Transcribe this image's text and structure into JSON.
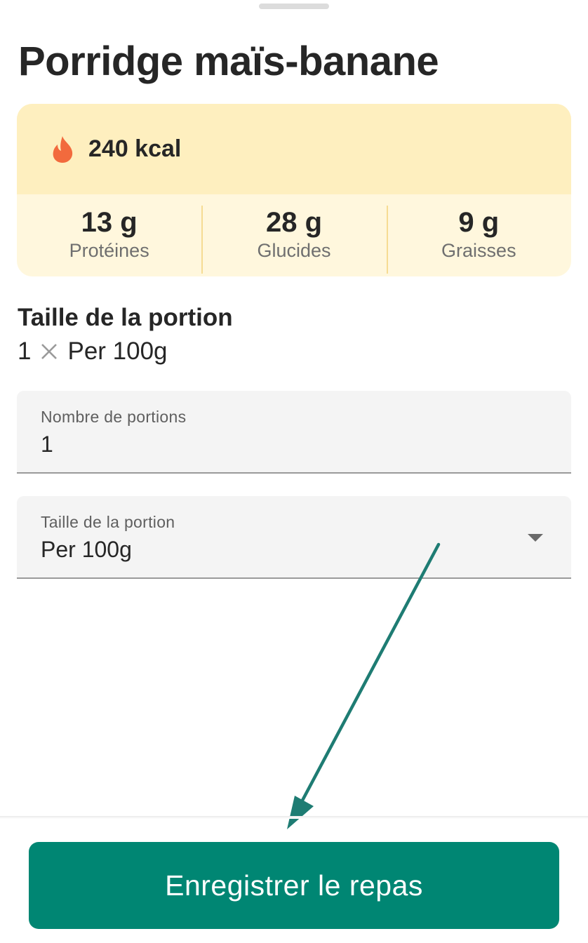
{
  "meal": {
    "title": "Porridge maïs-banane"
  },
  "nutrition": {
    "calories": "240 kcal",
    "calories_icon": "flame-icon",
    "macros": [
      {
        "value": "13 g",
        "label": "Protéines"
      },
      {
        "value": "28 g",
        "label": "Glucides"
      },
      {
        "value": "9 g",
        "label": "Graisses"
      }
    ]
  },
  "portion": {
    "heading": "Taille de la portion",
    "quantity": "1",
    "unit": "Per 100g"
  },
  "form": {
    "servings_label": "Nombre de portions",
    "servings_value": "1",
    "size_label": "Taille de la portion",
    "size_value": "Per 100g"
  },
  "actions": {
    "save_label": "Enregistrer le repas"
  },
  "colors": {
    "accent": "#008673",
    "calorie_band": "#feefbf",
    "macro_band": "#fff7dd",
    "flame": "#f26a3d",
    "annotation_arrow": "#1e7c73"
  }
}
